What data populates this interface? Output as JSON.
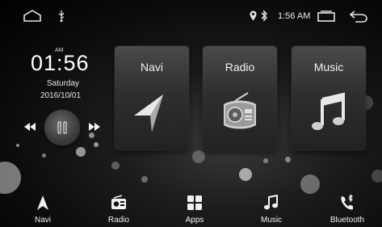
{
  "status": {
    "time": "1:56 AM",
    "icons": [
      "home-icon",
      "usb-icon",
      "location-icon",
      "bluetooth-icon",
      "recent-apps-icon",
      "back-icon"
    ]
  },
  "clock": {
    "ampm": "AM",
    "time": "01:56",
    "day": "Saturday",
    "date": "2016/10/01"
  },
  "media": {
    "icons": [
      "previous-icon",
      "play-pause-icon",
      "next-icon"
    ]
  },
  "tiles": [
    {
      "label": "Navi",
      "icon": "navigation-arrow-icon"
    },
    {
      "label": "Radio",
      "icon": "radio-icon"
    },
    {
      "label": "Music",
      "icon": "music-note-icon"
    }
  ],
  "dock": [
    {
      "label": "Navi",
      "icon": "navigation-arrow-icon"
    },
    {
      "label": "Radio",
      "icon": "radio-icon"
    },
    {
      "label": "Apps",
      "icon": "apps-grid-icon"
    },
    {
      "label": "Music",
      "icon": "music-note-icon"
    },
    {
      "label": "Bluetooth",
      "icon": "bluetooth-phone-icon"
    }
  ]
}
